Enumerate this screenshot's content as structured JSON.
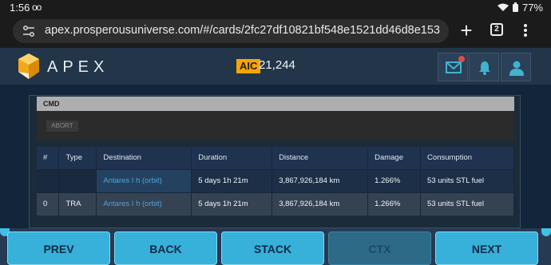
{
  "status_bar": {
    "time": "1:56",
    "glyph": "oo",
    "battery": "77%"
  },
  "browser": {
    "url": "apex.prosperousuniverse.com/#/cards/2fc27df10821bf548e1521dd46d8e153",
    "tabs_count": "2"
  },
  "header": {
    "app_name": "APEX",
    "currency_badge": "AIC",
    "balance": "21,244"
  },
  "cmd": {
    "label": "CMD",
    "abort_label": "ABORT"
  },
  "table": {
    "columns": [
      "#",
      "Type",
      "Destination",
      "Duration",
      "Distance",
      "Damage",
      "Consumption"
    ],
    "rows": [
      {
        "num": "",
        "type": "",
        "destination": "Antares I h (orbit)",
        "duration": "5 days 1h 21m",
        "distance": "3,867,926,184 km",
        "damage": "1.266%",
        "consumption": "53 units STL fuel"
      },
      {
        "num": "0",
        "type": "TRA",
        "destination": "Antares I h (orbit)",
        "duration": "5 days 1h 21m",
        "distance": "3,867,926,184 km",
        "damage": "1.266%",
        "consumption": "53 units STL fuel"
      }
    ]
  },
  "nav": {
    "prev": "PREV",
    "back": "BACK",
    "stack": "STACK",
    "ctx": "CTX",
    "next": "NEXT"
  },
  "icons": {
    "mail": "mail-icon",
    "bell": "bell-icon",
    "user": "user-icon",
    "logo": "apex-logo-icon"
  },
  "colors": {
    "header_bg": "#233548",
    "accent_gold": "#f7a600",
    "link_blue": "#53a2de",
    "nav_button": "#37b0da"
  }
}
